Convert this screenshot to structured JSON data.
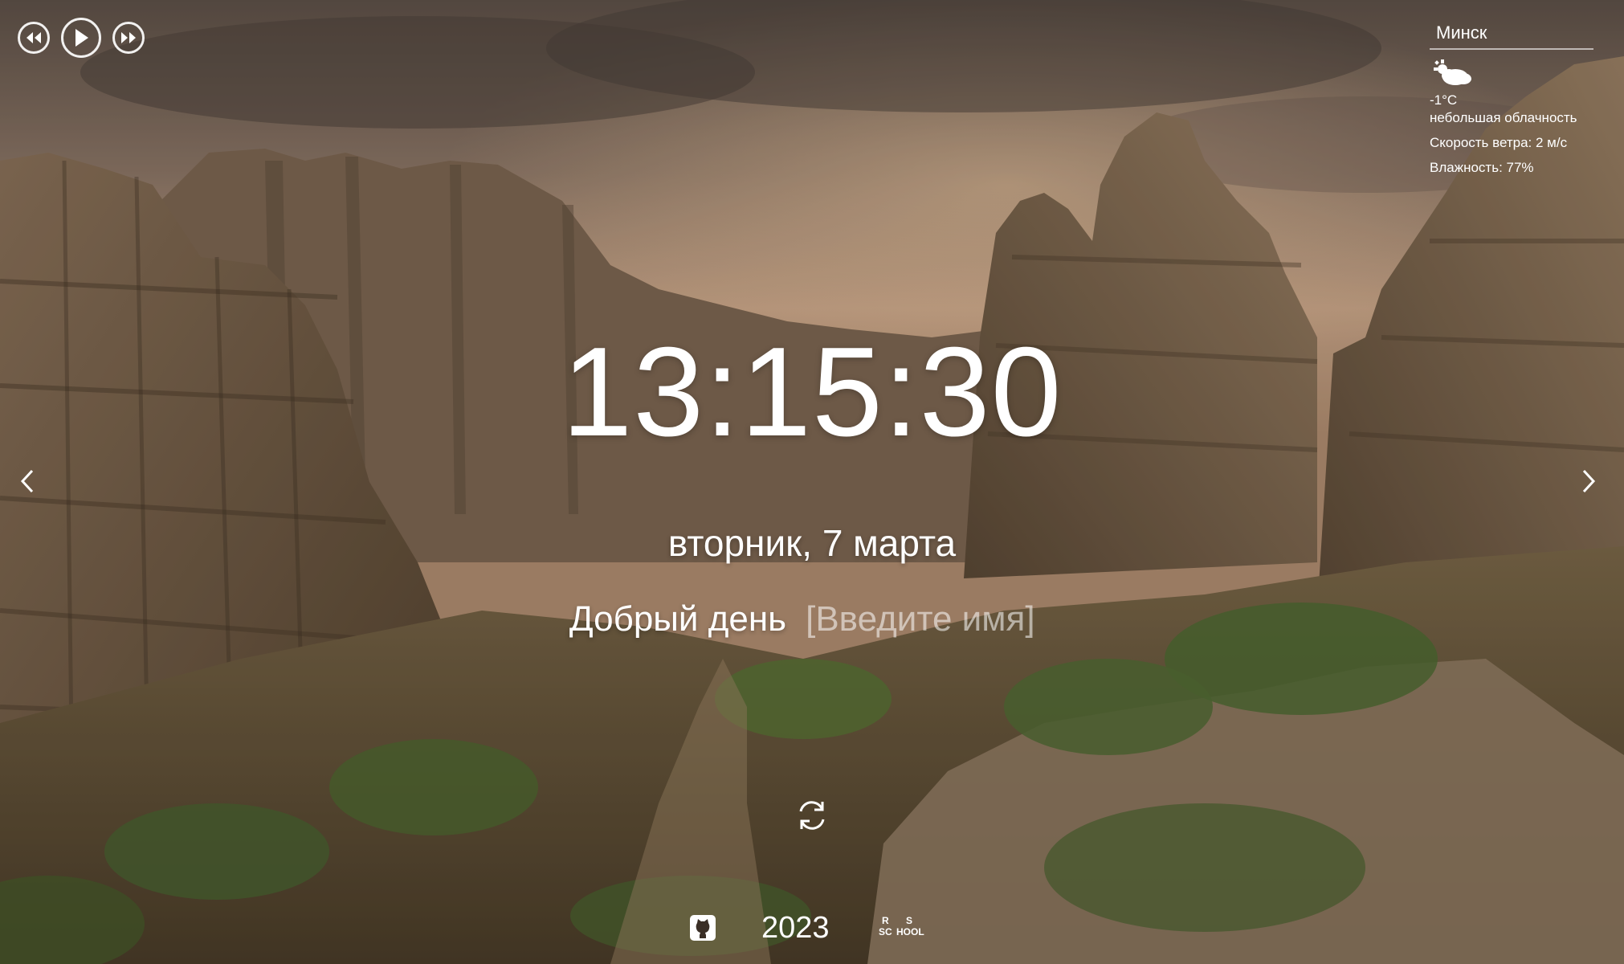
{
  "player": {
    "prev_icon": "rewind-icon",
    "play_icon": "play-icon",
    "next_icon": "fast-forward-icon"
  },
  "weather": {
    "city": "Минск",
    "icon": "cloudy-icon",
    "temperature": "-1°C",
    "description": "небольшая облачность",
    "wind": "Скорость ветра: 2 м/с",
    "humidity": "Влажность: 77%"
  },
  "clock": {
    "time": "13:15:30",
    "date": "вторник, 7 марта"
  },
  "greeting": {
    "text": "Добрый день",
    "name_placeholder": "[Введите имя]"
  },
  "slider": {
    "prev_icon": "chevron-left-icon",
    "next_icon": "chevron-right-icon"
  },
  "quote": {
    "refresh_icon": "refresh-icon"
  },
  "footer": {
    "github_icon": "github-icon",
    "year": "2023",
    "school_logo_text": "RS SCHOOL"
  },
  "colors": {
    "text": "#ffffff"
  }
}
